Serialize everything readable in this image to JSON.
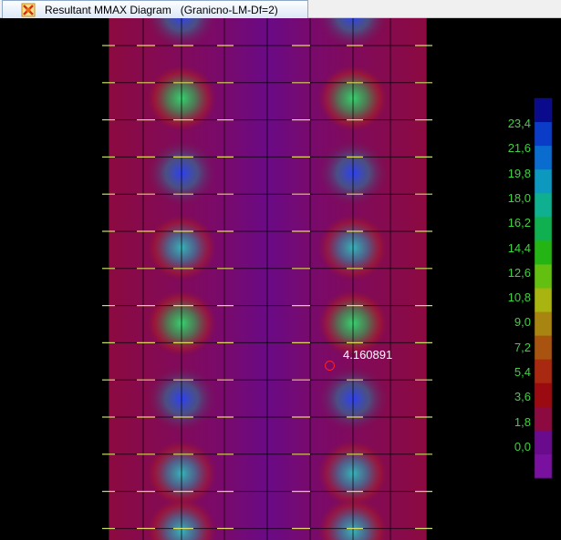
{
  "window": {
    "title": "Resultant MMAX Diagram   (Granicno-LM-Df=2)"
  },
  "colors": {
    "background": "#000000",
    "grid_line": "#000000",
    "support_line": "#ffff66",
    "legend_text": "#3fd23f",
    "probe_marker": "#ff2020",
    "probe_text": "#ffffff"
  },
  "legend": {
    "labels": [
      "23,4",
      "21,6",
      "19,8",
      "18,0",
      "16,2",
      "14,4",
      "12,6",
      "10,8",
      "9,0",
      "7,2",
      "5,4",
      "3,6",
      "1,8",
      "0,0"
    ],
    "bands": [
      "#0a0a8c",
      "#0a3cc8",
      "#0b6cd0",
      "#0d98c0",
      "#0fb090",
      "#10b050",
      "#24b414",
      "#64c010",
      "#aab410",
      "#a88410",
      "#a85410",
      "#a82810",
      "#9a0a10",
      "#8c0a40",
      "#6a0a8c",
      "#7a10a0"
    ]
  },
  "probe": {
    "value": "4.160891"
  }
}
